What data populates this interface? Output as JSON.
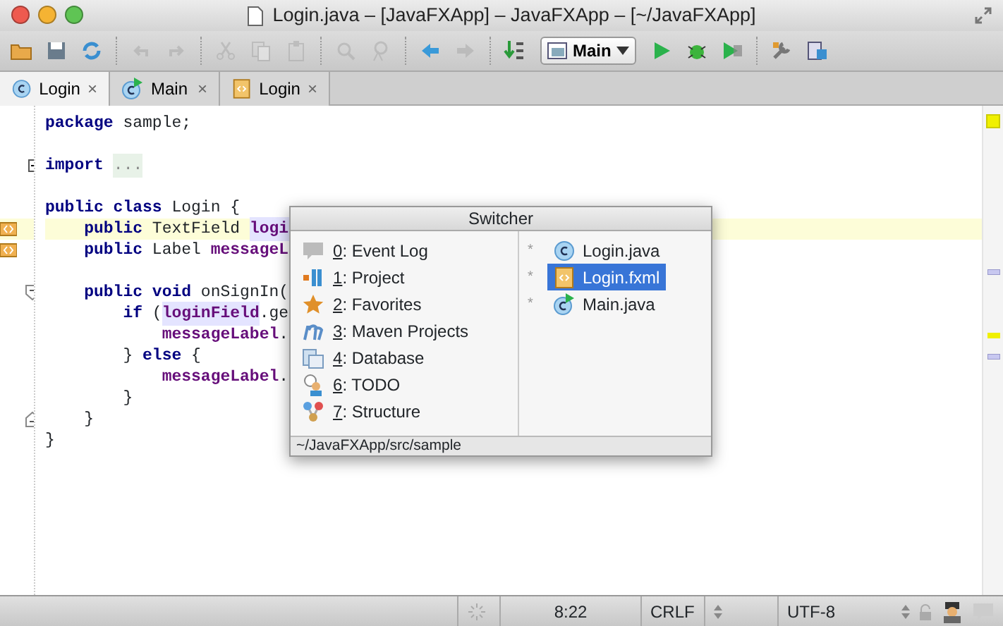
{
  "window": {
    "title": "Login.java – [JavaFXApp] – JavaFXApp – [~/JavaFXApp]"
  },
  "toolbar": [
    {
      "kind": "open",
      "disabled": false
    },
    {
      "kind": "save",
      "disabled": false
    },
    {
      "kind": "sync",
      "disabled": false
    },
    {
      "kind": "sep"
    },
    {
      "kind": "undo",
      "disabled": true
    },
    {
      "kind": "redo",
      "disabled": true
    },
    {
      "kind": "sep"
    },
    {
      "kind": "cut",
      "disabled": true
    },
    {
      "kind": "copy",
      "disabled": true
    },
    {
      "kind": "paste",
      "disabled": true
    },
    {
      "kind": "sep"
    },
    {
      "kind": "find",
      "disabled": true
    },
    {
      "kind": "replace",
      "disabled": true
    },
    {
      "kind": "sep"
    },
    {
      "kind": "back",
      "disabled": false
    },
    {
      "kind": "forward",
      "disabled": true
    },
    {
      "kind": "sep"
    },
    {
      "kind": "build",
      "disabled": false
    },
    {
      "kind": "config",
      "label": "Main"
    },
    {
      "kind": "run",
      "disabled": false
    },
    {
      "kind": "debug",
      "disabled": false
    },
    {
      "kind": "coverage",
      "disabled": false
    },
    {
      "kind": "sep"
    },
    {
      "kind": "settings",
      "disabled": false
    },
    {
      "kind": "structure",
      "disabled": false
    }
  ],
  "tabs": [
    {
      "label": "Login",
      "kind": "class",
      "close": "×",
      "selected": true
    },
    {
      "label": "Main",
      "kind": "main",
      "close": "×",
      "selected": false
    },
    {
      "label": "Login",
      "kind": "fxml",
      "close": "×",
      "selected": false
    }
  ],
  "editor": {
    "lines": [
      {
        "kind": "code",
        "segments": [
          {
            "text": "package",
            "kind": "kw"
          },
          {
            "text": " sample;",
            "kind": "plain"
          }
        ]
      },
      {
        "kind": "blank"
      },
      {
        "kind": "code",
        "gutter": {
          "kind": "expand"
        },
        "segments": [
          {
            "text": "import",
            "kind": "kw"
          },
          {
            "text": "...",
            "kind": "folded"
          }
        ]
      },
      {
        "kind": "blank"
      },
      {
        "kind": "code",
        "segments": [
          {
            "text": "public class",
            "kind": "kw"
          },
          {
            "text": " Login {",
            "kind": "plain"
          }
        ]
      },
      {
        "kind": "code",
        "gutter": {
          "kind": "fxml"
        },
        "highlighted": true,
        "segments": [
          {
            "text": "    public",
            "kind": "kw"
          },
          {
            "text": " TextField ",
            "kind": "plain"
          },
          {
            "text": "logi",
            "kind": "field",
            "marked": true
          }
        ]
      },
      {
        "kind": "code",
        "gutter": {
          "kind": "fxml"
        },
        "stripe": {
          "kind": "usage"
        },
        "segments": [
          {
            "text": "    public",
            "kind": "kw"
          },
          {
            "text": " Label ",
            "kind": "plain"
          },
          {
            "text": "messageL",
            "kind": "field"
          }
        ]
      },
      {
        "kind": "blank"
      },
      {
        "kind": "code",
        "gutter": {
          "kind": "fold"
        },
        "segments": [
          {
            "text": "    public void",
            "kind": "kw"
          },
          {
            "text": " onSignIn(",
            "kind": "plain"
          }
        ]
      },
      {
        "kind": "code",
        "stripe": {
          "kind": "warning"
        },
        "segments": [
          {
            "text": "        if",
            "kind": "kw"
          },
          {
            "text": " (",
            "kind": "plain"
          },
          {
            "text": "loginField",
            "kind": "field",
            "marked": true
          },
          {
            "text": ".ge",
            "kind": "plain"
          }
        ]
      },
      {
        "kind": "code",
        "stripe": {
          "kind": "usage"
        },
        "segments": [
          {
            "text": "            messageLabel",
            "kind": "field"
          },
          {
            "text": ".",
            "kind": "plain"
          }
        ]
      },
      {
        "kind": "code",
        "segments": [
          {
            "text": "        } ",
            "kind": "plain"
          },
          {
            "text": "else",
            "kind": "kw"
          },
          {
            "text": " {",
            "kind": "plain"
          }
        ]
      },
      {
        "kind": "code",
        "segments": [
          {
            "text": "            messageLabel",
            "kind": "field"
          },
          {
            "text": ".",
            "kind": "plain"
          }
        ]
      },
      {
        "kind": "code",
        "segments": [
          {
            "text": "        }",
            "kind": "plain"
          }
        ]
      },
      {
        "kind": "code",
        "gutter": {
          "kind": "foldend"
        },
        "segments": [
          {
            "text": "    }",
            "kind": "plain"
          }
        ]
      },
      {
        "kind": "code",
        "segments": [
          {
            "text": "}",
            "kind": "plain"
          }
        ]
      }
    ]
  },
  "switcher": {
    "title": "Switcher",
    "tools": [
      {
        "mnemonic": "0",
        "label": ": Event Log",
        "kind": "balloon"
      },
      {
        "mnemonic": "1",
        "label": ": Project",
        "kind": "project"
      },
      {
        "mnemonic": "2",
        "label": ": Favorites",
        "kind": "star"
      },
      {
        "mnemonic": "3",
        "label": ": Maven Projects",
        "kind": "maven"
      },
      {
        "mnemonic": "4",
        "label": ": Database",
        "kind": "database"
      },
      {
        "mnemonic": "6",
        "label": ": TODO",
        "kind": "todo"
      },
      {
        "mnemonic": "7",
        "label": ": Structure",
        "kind": "structure"
      }
    ],
    "files": [
      {
        "mark": "*",
        "label": "Login.java",
        "kind": "class",
        "selected": false
      },
      {
        "mark": "*",
        "label": "Login.fxml",
        "kind": "fxml",
        "selected": true
      },
      {
        "mark": "*",
        "label": "Main.java",
        "kind": "main",
        "selected": false
      }
    ],
    "path": "~/JavaFXApp/src/sample"
  },
  "status_bar": {
    "position": "8:22",
    "line_separator": "CRLF",
    "encoding": "UTF-8"
  }
}
